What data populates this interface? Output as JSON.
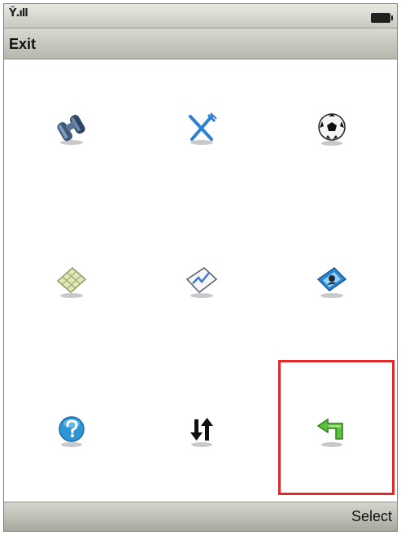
{
  "status": {
    "signal_icon": "signal-strength-icon",
    "battery_icon": "battery-icon"
  },
  "title_bar": {
    "left_softkey": "Exit"
  },
  "menu": {
    "items": [
      {
        "icon": "binoculars-icon"
      },
      {
        "icon": "fork-knife-icon"
      },
      {
        "icon": "soccer-ball-icon"
      },
      {
        "icon": "map-grid-icon"
      },
      {
        "icon": "chart-icon"
      },
      {
        "icon": "contact-card-icon"
      },
      {
        "icon": "help-icon"
      },
      {
        "icon": "sort-arrows-icon"
      },
      {
        "icon": "back-arrow-icon",
        "selected": true
      }
    ],
    "highlight_color": "#e32a2a"
  },
  "soft_keys": {
    "right": "Select"
  }
}
